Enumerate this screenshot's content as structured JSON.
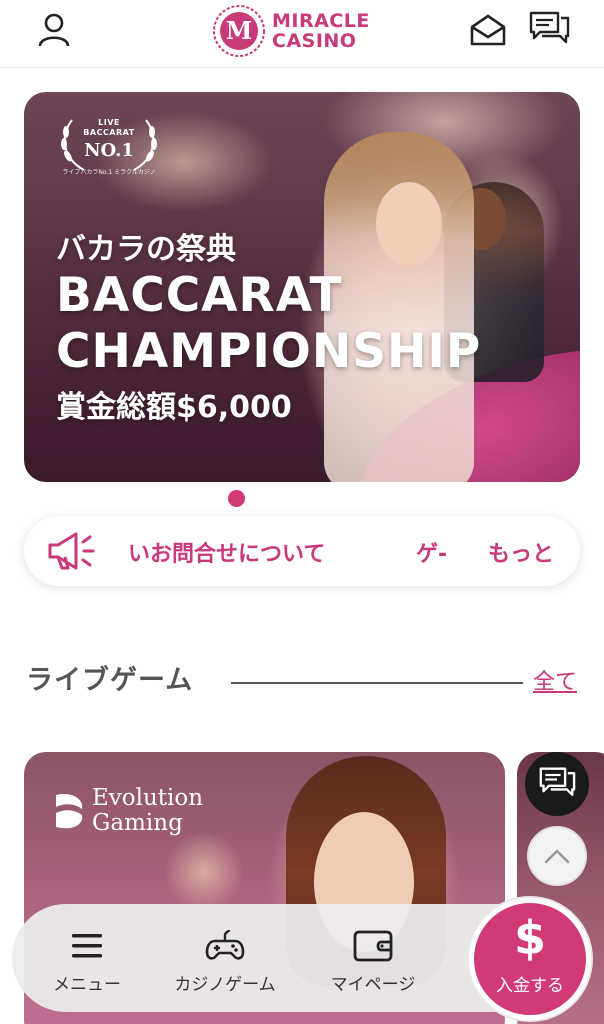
{
  "header": {
    "logo_line1": "MIRACLE",
    "logo_line2": "CASINO",
    "logo_mark": "M",
    "icons": [
      "user-icon",
      "mail-icon",
      "chat-icon"
    ],
    "brand_color": "#c83a78"
  },
  "hero": {
    "badge_live": "LIVE",
    "badge_baccarat": "BACCARAT",
    "badge_no1": "NO.1",
    "badge_sub": "ライブバカラNo.1 ミラクルカジノ",
    "subtitle": "バカラの祭典",
    "title_line1": "BACCARAT",
    "title_line2": "CHAMPIONSHIP",
    "prize": "賞金総額$6,000"
  },
  "notice": {
    "icon": "megaphone-icon",
    "ticker": "いお問合せについて",
    "ticker_next": "ゲ-",
    "more": "もっと"
  },
  "section": {
    "title": "ライブゲーム",
    "all": "全て"
  },
  "cards": [
    {
      "provider_line1": "Evolution",
      "provider_line2": "Gaming"
    }
  ],
  "bottom_nav": {
    "items": [
      {
        "label": "メニュー",
        "icon": "menu-icon"
      },
      {
        "label": "カジノゲーム",
        "icon": "gamepad-icon"
      },
      {
        "label": "マイページ",
        "icon": "wallet-icon"
      }
    ],
    "deposit_symbol": "$",
    "deposit_label": "入金する",
    "accent_color": "#d23a77"
  }
}
